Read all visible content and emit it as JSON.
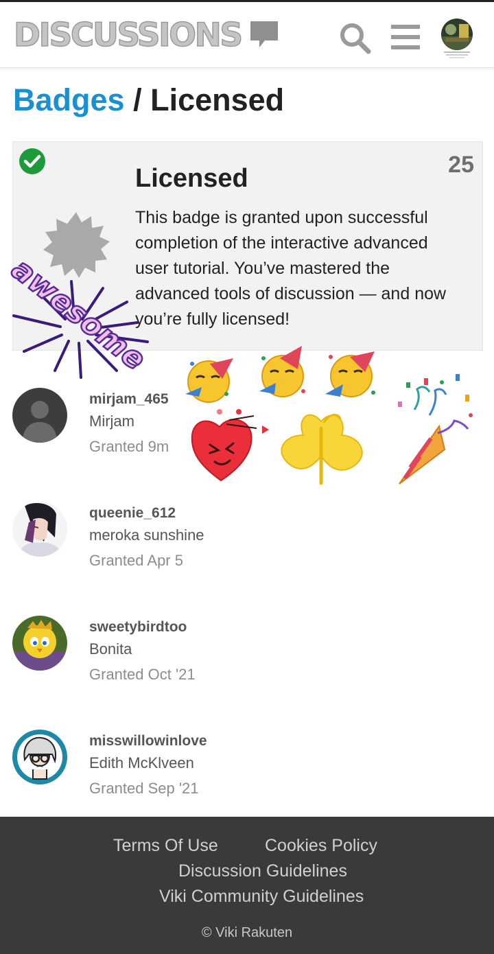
{
  "header": {
    "logo_text": "DISCUSSIONS",
    "icons": {
      "logo": "chat-bubble-icon",
      "search": "search-icon",
      "menu": "hamburger-menu-icon",
      "profile": "profile-avatar"
    }
  },
  "breadcrumb": {
    "parent": "Badges",
    "separator": " / ",
    "current": "Licensed"
  },
  "badge": {
    "title": "Licensed",
    "count": "25",
    "description": "This badge is granted upon successful completion of the interactive advanced user tutorial. You’ve mastered the advanced tools of discussion — and now you’re fully licensed!",
    "granted_status_icon": "check-circle-icon",
    "badge_icon": "gear-badge-icon"
  },
  "overlay": {
    "sticker_text": "awesome"
  },
  "users": [
    {
      "username": "mirjam_465",
      "display_name": "Mirjam",
      "granted": "Granted 9m",
      "avatar": "default-avatar"
    },
    {
      "username": "queenie_612",
      "display_name": "meroka sunshine",
      "granted": "Granted Apr 5",
      "avatar": "anime-avatar"
    },
    {
      "username": "sweetybirdtoo",
      "display_name": "Bonita",
      "granted": "Granted Oct '21",
      "avatar": "yellow-bird-avatar"
    },
    {
      "username": "misswillowinlove",
      "display_name": "Edith McKlveen",
      "granted": "Granted Sep '21",
      "avatar": "cartoon-woman-avatar"
    }
  ],
  "footer": {
    "terms": "Terms Of Use",
    "cookies": "Cookies Policy",
    "discussion_guidelines": "Discussion Guidelines",
    "community_guidelines": "Viki Community Guidelines",
    "copyright": "© Viki Rakuten"
  },
  "colors": {
    "link": "#1a8fd1",
    "check": "#1f9a3a",
    "footer_bg": "#3a3a3a",
    "card_bg": "#f2f2f2"
  }
}
